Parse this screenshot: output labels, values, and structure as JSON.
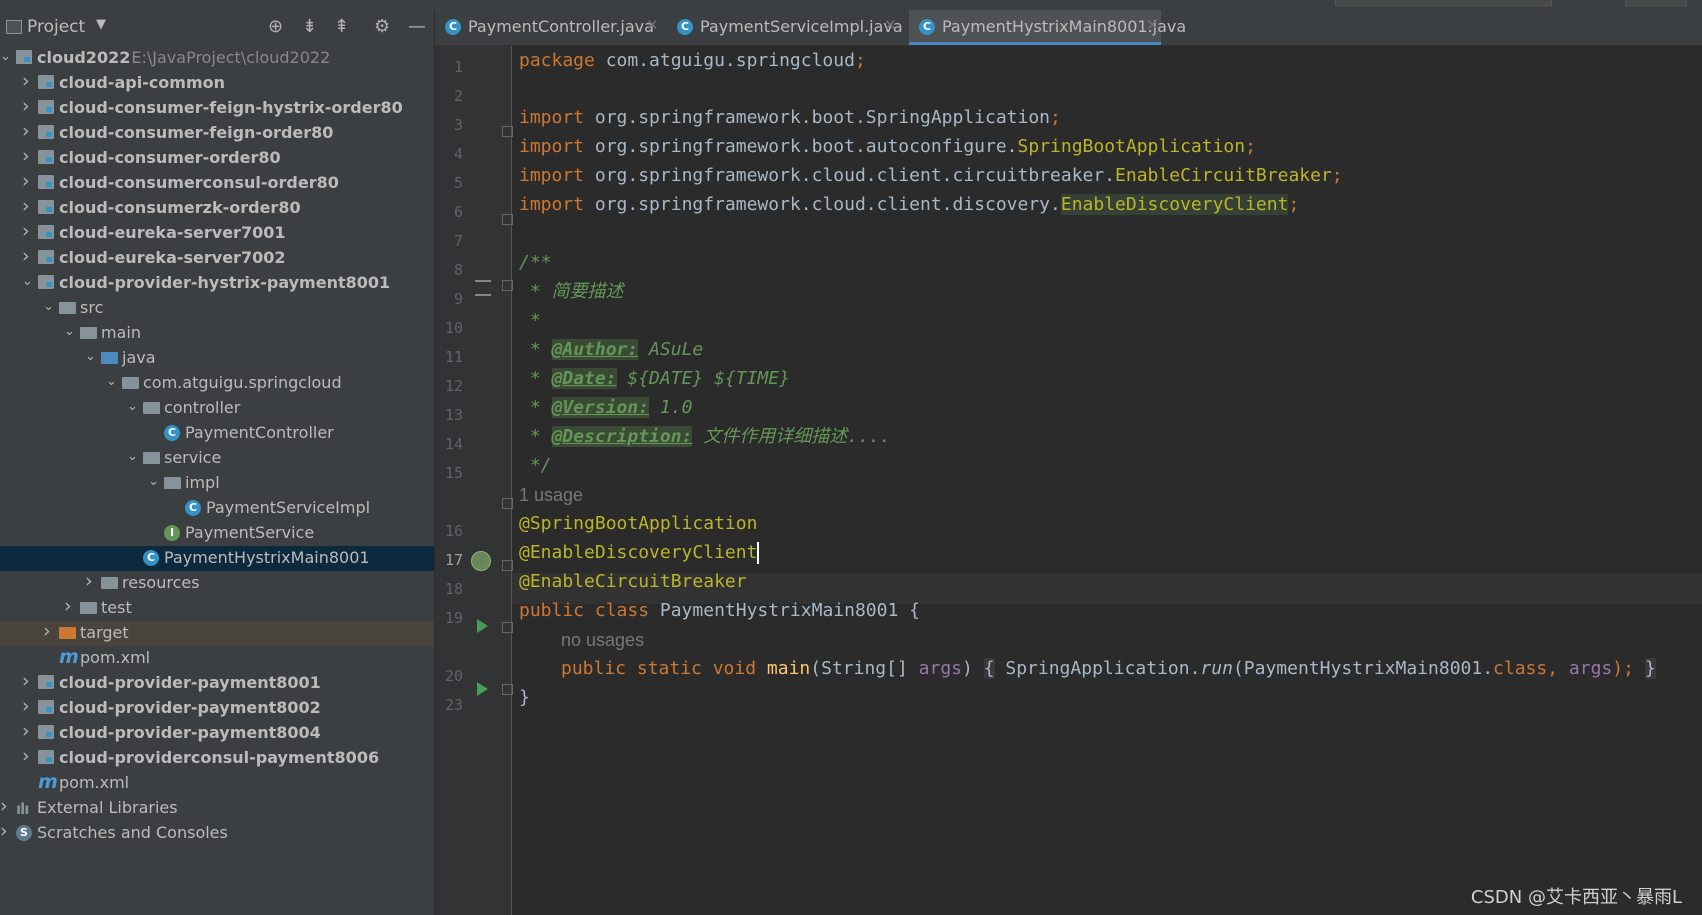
{
  "project_panel": {
    "title": "Project",
    "tree": [
      {
        "label": "cloud2022",
        "path": "E:\\JavaProject\\cloud2022",
        "depth": 0,
        "arrow": "down",
        "icon": "module",
        "bold": true
      },
      {
        "label": "cloud-api-common",
        "depth": 1,
        "arrow": "right",
        "icon": "module",
        "bold": true
      },
      {
        "label": "cloud-consumer-feign-hystrix-order80",
        "depth": 1,
        "arrow": "right",
        "icon": "module",
        "bold": true
      },
      {
        "label": "cloud-consumer-feign-order80",
        "depth": 1,
        "arrow": "right",
        "icon": "module",
        "bold": true
      },
      {
        "label": "cloud-consumer-order80",
        "depth": 1,
        "arrow": "right",
        "icon": "module",
        "bold": true
      },
      {
        "label": "cloud-consumerconsul-order80",
        "depth": 1,
        "arrow": "right",
        "icon": "module",
        "bold": true
      },
      {
        "label": "cloud-consumerzk-order80",
        "depth": 1,
        "arrow": "right",
        "icon": "module",
        "bold": true
      },
      {
        "label": "cloud-eureka-server7001",
        "depth": 1,
        "arrow": "right",
        "icon": "module",
        "bold": true
      },
      {
        "label": "cloud-eureka-server7002",
        "depth": 1,
        "arrow": "right",
        "icon": "module",
        "bold": true
      },
      {
        "label": "cloud-provider-hystrix-payment8001",
        "depth": 1,
        "arrow": "down",
        "icon": "module",
        "bold": true
      },
      {
        "label": "src",
        "depth": 2,
        "arrow": "down",
        "icon": "folder"
      },
      {
        "label": "main",
        "depth": 3,
        "arrow": "down",
        "icon": "folder"
      },
      {
        "label": "java",
        "depth": 4,
        "arrow": "down",
        "icon": "folder-blue"
      },
      {
        "label": "com.atguigu.springcloud",
        "depth": 5,
        "arrow": "down",
        "icon": "package"
      },
      {
        "label": "controller",
        "depth": 6,
        "arrow": "down",
        "icon": "package"
      },
      {
        "label": "PaymentController",
        "depth": 7,
        "arrow": "",
        "icon": "class"
      },
      {
        "label": "service",
        "depth": 6,
        "arrow": "down",
        "icon": "package"
      },
      {
        "label": "impl",
        "depth": 7,
        "arrow": "down",
        "icon": "package"
      },
      {
        "label": "PaymentServiceImpl",
        "depth": 8,
        "arrow": "",
        "icon": "class"
      },
      {
        "label": "PaymentService",
        "depth": 7,
        "arrow": "",
        "icon": "interface"
      },
      {
        "label": "PaymentHystrixMain8001",
        "depth": 6,
        "arrow": "",
        "icon": "class-spring",
        "selected": true
      },
      {
        "label": "resources",
        "depth": 4,
        "arrow": "right",
        "icon": "folder"
      },
      {
        "label": "test",
        "depth": 3,
        "arrow": "right",
        "icon": "folder"
      },
      {
        "label": "target",
        "depth": 2,
        "arrow": "right",
        "icon": "folder-orange",
        "excluded": true
      },
      {
        "label": "pom.xml",
        "depth": 2,
        "arrow": "",
        "icon": "maven"
      },
      {
        "label": "cloud-provider-payment8001",
        "depth": 1,
        "arrow": "right",
        "icon": "module",
        "bold": true
      },
      {
        "label": "cloud-provider-payment8002",
        "depth": 1,
        "arrow": "right",
        "icon": "module",
        "bold": true
      },
      {
        "label": "cloud-provider-payment8004",
        "depth": 1,
        "arrow": "right",
        "icon": "module",
        "bold": true
      },
      {
        "label": "cloud-providerconsul-payment8006",
        "depth": 1,
        "arrow": "right",
        "icon": "module",
        "bold": true
      },
      {
        "label": "pom.xml",
        "depth": 1,
        "arrow": "",
        "icon": "maven"
      },
      {
        "label": "External Libraries",
        "depth": 0,
        "arrow": "right",
        "icon": "libraries"
      },
      {
        "label": "Scratches and Consoles",
        "depth": 0,
        "arrow": "right",
        "icon": "scratches"
      }
    ]
  },
  "tabs": [
    {
      "label": "PaymentController.java",
      "active": false
    },
    {
      "label": "PaymentServiceImpl.java",
      "active": false
    },
    {
      "label": "PaymentHystrixMain8001.java",
      "active": true
    }
  ],
  "editor": {
    "current_line": "17",
    "line_numbers": [
      "1",
      "2",
      "3",
      "4",
      "5",
      "6",
      "7",
      "8",
      "9",
      "10",
      "11",
      "12",
      "13",
      "14",
      "15",
      "",
      "16",
      "17",
      "18",
      "19",
      "",
      "20",
      "23"
    ],
    "code": {
      "pkg_kw": "package",
      "pkg_name": " com.atguigu.springcloud",
      "semi": ";",
      "import_kw": "import",
      "imp1": " org.springframework.boot.SpringApplication",
      "imp2a": " org.springframework.boot.autoconfigure.",
      "imp2b": "SpringBootApplication",
      "imp3a": " org.springframework.cloud.client.circuitbreaker.",
      "imp3b": "EnableCircuitBreaker",
      "imp4a": " org.springframework.cloud.client.discovery.",
      "imp4b": "EnableDiscoveryClient",
      "doc_open": "/**",
      "doc_desc": " * 简要描述",
      "doc_star": " *",
      "doc_star_sp": " * ",
      "tag_author": "@Author:",
      "val_author": " ASuLe",
      "tag_date": "@Date:",
      "val_date": " ${DATE} ${TIME}",
      "tag_version": "@Version:",
      "val_version": " 1.0",
      "tag_desc": "@Description:",
      "val_desc": " 文件作用详细描述....",
      "doc_close": " */",
      "hint_usage": "1 usage",
      "ann1": "@SpringBootApplication",
      "ann2": "@EnableDiscoveryClient",
      "ann3": "@EnableCircuitBreaker",
      "class_kw": "public class",
      "class_name": " PaymentHystrixMain8001 ",
      "brace_open": "{",
      "hint_no_usages": "no usages",
      "main_kw": "public static void",
      "main_name": " main",
      "main_params": "(String[] ",
      "main_args": "args",
      "main_close": ") ",
      "main_body_open": "{",
      "main_body_call": " SpringApplication.",
      "main_run": "run",
      "main_body_args": "(PaymentHystrixMain8001.",
      "main_class_kw": "class",
      "main_comma": ", ",
      "main_args2": "args",
      "main_end": ");",
      "main_body_close": "}",
      "brace_close": "}"
    }
  },
  "watermark": "CSDN @艾卡西亚丶暴雨L"
}
